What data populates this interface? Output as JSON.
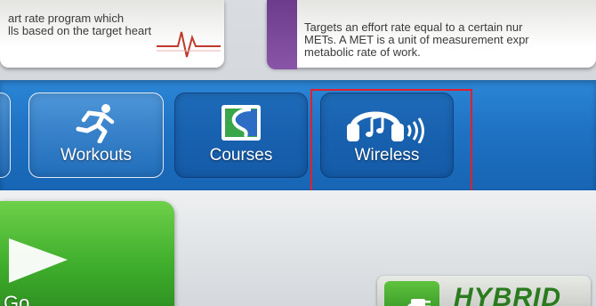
{
  "program_cards": [
    {
      "lines": [
        "art rate program which",
        "lls based on the target heart"
      ]
    },
    {
      "lines": [
        "Targets an effort rate equal to a certain nur",
        "METs. A MET is a unit of measurement expr",
        "metabolic rate of work."
      ]
    }
  ],
  "nav": {
    "tiles": [
      {
        "label": "Workouts",
        "icon": "running-man-icon"
      },
      {
        "label": "Courses",
        "icon": "course-map-icon"
      },
      {
        "label": "Wireless",
        "icon": "headphones-icon"
      }
    ]
  },
  "bottom": {
    "go_label": "Go",
    "hybrid_label": "HYBRID"
  },
  "colors": {
    "band_blue": "#1f72c4",
    "go_green": "#3fae2c",
    "highlight_red": "#e41e2a",
    "card_purple": "#7a4a9c"
  }
}
